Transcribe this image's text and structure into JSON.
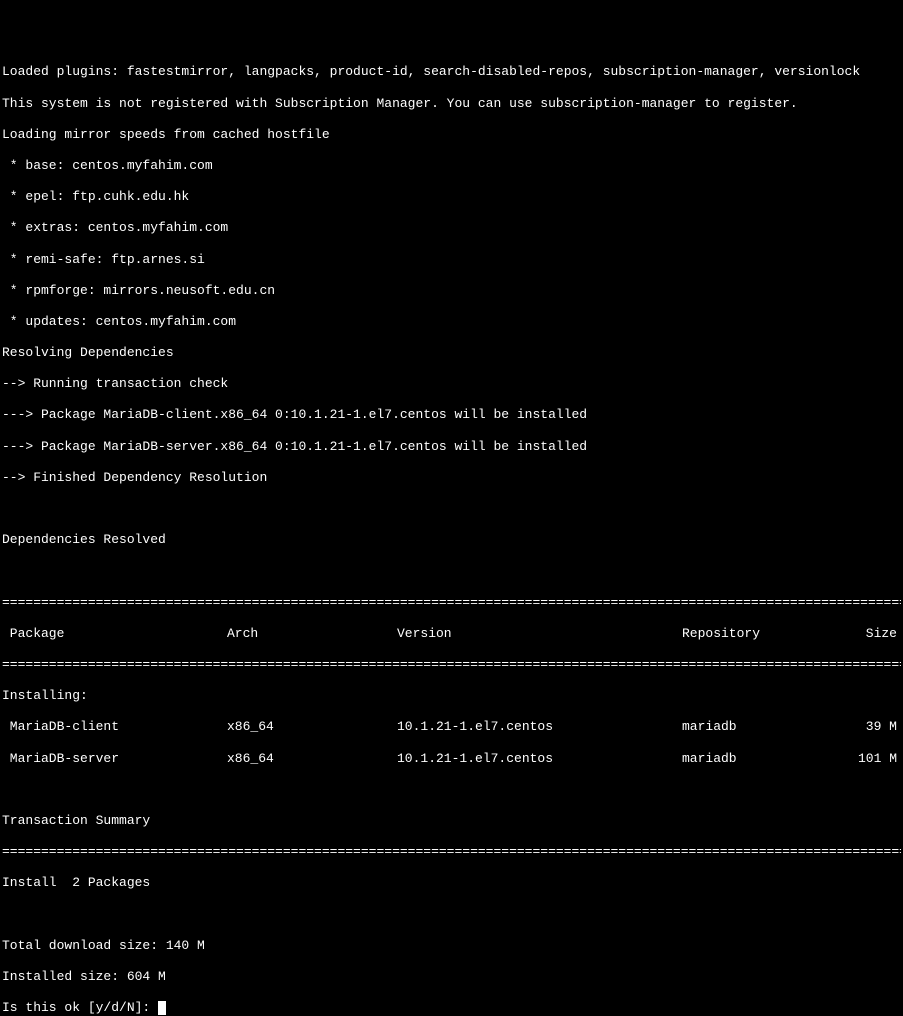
{
  "preamble": {
    "plugins": "Loaded plugins: fastestmirror, langpacks, product-id, search-disabled-repos, subscription-manager, versionlock",
    "subscription_warn": "This system is not registered with Subscription Manager. You can use subscription-manager to register.",
    "loading_mirrors": "Loading mirror speeds from cached hostfile",
    "mirrors": [
      " * base: centos.myfahim.com",
      " * epel: ftp.cuhk.edu.hk",
      " * extras: centos.myfahim.com",
      " * remi-safe: ftp.arnes.si",
      " * rpmforge: mirrors.neusoft.edu.cn",
      " * updates: centos.myfahim.com"
    ],
    "resolving": "Resolving Dependencies",
    "running_check": "--> Running transaction check",
    "pkg1": "---> Package MariaDB-client.x86_64 0:10.1.21-1.el7.centos will be installed",
    "pkg2": "---> Package MariaDB-server.x86_64 0:10.1.21-1.el7.centos will be installed",
    "finished": "--> Finished Dependency Resolution",
    "deps_resolved": "Dependencies Resolved"
  },
  "table": {
    "headers": {
      "package": " Package",
      "arch": "Arch",
      "version": "Version",
      "repository": "Repository",
      "size": "Size"
    },
    "installing_label": "Installing:",
    "rows": [
      {
        "package": " MariaDB-client",
        "arch": "x86_64",
        "version": "10.1.21-1.el7.centos",
        "repository": "mariadb",
        "size": "39 M"
      },
      {
        "package": " MariaDB-server",
        "arch": "x86_64",
        "version": "10.1.21-1.el7.centos",
        "repository": "mariadb",
        "size": "101 M"
      }
    ]
  },
  "summary": {
    "transaction_summary": "Transaction Summary",
    "install_count": "Install  2 Packages",
    "download_size": "Total download size: 140 M",
    "installed_size": "Installed size: 604 M",
    "prompt": "Is this ok [y/d/N]: "
  },
  "divider": "======================================================================================================================="
}
